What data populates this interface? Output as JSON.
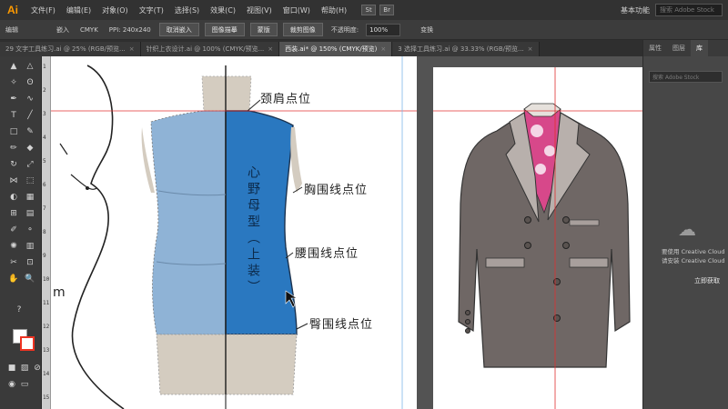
{
  "app": {
    "logo": "Ai"
  },
  "menu": [
    "文件(F)",
    "编辑(E)",
    "对象(O)",
    "文字(T)",
    "选择(S)",
    "效果(C)",
    "视图(V)",
    "窗口(W)",
    "帮助(H)"
  ],
  "menu_right": {
    "workspace": "基本功能",
    "search_placeholder": "搜索 Adobe Stock",
    "icons": [
      "St",
      "Br"
    ]
  },
  "controlbar": {
    "label_edit": "编辑",
    "embed_label": "嵌入",
    "color_info": "CMYK",
    "ppi_info": "PPI: 240x240",
    "cancel_embed": "取消嵌入",
    "image_trace": "图像描摹",
    "mask": "蒙版",
    "crop_image": "裁剪图像",
    "opacity_label": "不透明度:",
    "opacity_value": "100%",
    "transform": "变换"
  },
  "tabs": [
    {
      "label": "29 文字工具练习.ai @ 25% (RGB/预览...",
      "active": false
    },
    {
      "label": "针织上衣设计.ai @ 100% (CMYK/预览...",
      "active": false
    },
    {
      "label": "西装.ai* @ 150% (CMYK/预览)",
      "active": true
    },
    {
      "label": "3 选择工具练习.ai @ 33.33% (RGB/预览...",
      "active": false
    }
  ],
  "ruler": {
    "marks": [
      "1",
      "2",
      "3",
      "4",
      "5",
      "6",
      "7",
      "8",
      "9",
      "10",
      "11",
      "12",
      "13",
      "14",
      "15"
    ]
  },
  "canvas": {
    "labels": {
      "neck_shoulder": "颈肩点位",
      "chest_line": "胸围线点位",
      "waist_line": "腰围线点位",
      "hip_line": "臀围线点位",
      "prototype": "心野母型（上装）",
      "m_char": "m"
    }
  },
  "rightpanel": {
    "tabs": [
      "属性",
      "图层",
      "库"
    ],
    "search_placeholder": "搜索 Adobe Stock",
    "cc_line1": "要使用 Creative Cloud",
    "cc_line2": "请安装 Creative Cloud",
    "cc_link": "立即获取"
  },
  "colors": {
    "accent": "#ff9a00",
    "blue_panel": "#2a78c0",
    "light_blue": "#8fb3d6",
    "beige": "#d4ccc0",
    "jacket": "#6f6765",
    "lapel": "#b8b0ac",
    "guide": "#e03030"
  }
}
